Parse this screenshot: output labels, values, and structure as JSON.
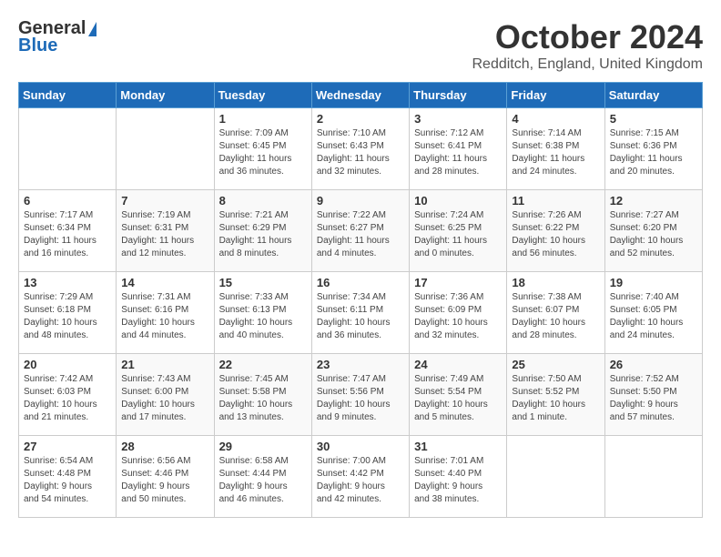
{
  "header": {
    "logo_general": "General",
    "logo_blue": "Blue",
    "month_title": "October 2024",
    "location": "Redditch, England, United Kingdom"
  },
  "weekdays": [
    "Sunday",
    "Monday",
    "Tuesday",
    "Wednesday",
    "Thursday",
    "Friday",
    "Saturday"
  ],
  "weeks": [
    [
      {
        "day": "",
        "info": ""
      },
      {
        "day": "",
        "info": ""
      },
      {
        "day": "1",
        "info": "Sunrise: 7:09 AM\nSunset: 6:45 PM\nDaylight: 11 hours\nand 36 minutes."
      },
      {
        "day": "2",
        "info": "Sunrise: 7:10 AM\nSunset: 6:43 PM\nDaylight: 11 hours\nand 32 minutes."
      },
      {
        "day": "3",
        "info": "Sunrise: 7:12 AM\nSunset: 6:41 PM\nDaylight: 11 hours\nand 28 minutes."
      },
      {
        "day": "4",
        "info": "Sunrise: 7:14 AM\nSunset: 6:38 PM\nDaylight: 11 hours\nand 24 minutes."
      },
      {
        "day": "5",
        "info": "Sunrise: 7:15 AM\nSunset: 6:36 PM\nDaylight: 11 hours\nand 20 minutes."
      }
    ],
    [
      {
        "day": "6",
        "info": "Sunrise: 7:17 AM\nSunset: 6:34 PM\nDaylight: 11 hours\nand 16 minutes."
      },
      {
        "day": "7",
        "info": "Sunrise: 7:19 AM\nSunset: 6:31 PM\nDaylight: 11 hours\nand 12 minutes."
      },
      {
        "day": "8",
        "info": "Sunrise: 7:21 AM\nSunset: 6:29 PM\nDaylight: 11 hours\nand 8 minutes."
      },
      {
        "day": "9",
        "info": "Sunrise: 7:22 AM\nSunset: 6:27 PM\nDaylight: 11 hours\nand 4 minutes."
      },
      {
        "day": "10",
        "info": "Sunrise: 7:24 AM\nSunset: 6:25 PM\nDaylight: 11 hours\nand 0 minutes."
      },
      {
        "day": "11",
        "info": "Sunrise: 7:26 AM\nSunset: 6:22 PM\nDaylight: 10 hours\nand 56 minutes."
      },
      {
        "day": "12",
        "info": "Sunrise: 7:27 AM\nSunset: 6:20 PM\nDaylight: 10 hours\nand 52 minutes."
      }
    ],
    [
      {
        "day": "13",
        "info": "Sunrise: 7:29 AM\nSunset: 6:18 PM\nDaylight: 10 hours\nand 48 minutes."
      },
      {
        "day": "14",
        "info": "Sunrise: 7:31 AM\nSunset: 6:16 PM\nDaylight: 10 hours\nand 44 minutes."
      },
      {
        "day": "15",
        "info": "Sunrise: 7:33 AM\nSunset: 6:13 PM\nDaylight: 10 hours\nand 40 minutes."
      },
      {
        "day": "16",
        "info": "Sunrise: 7:34 AM\nSunset: 6:11 PM\nDaylight: 10 hours\nand 36 minutes."
      },
      {
        "day": "17",
        "info": "Sunrise: 7:36 AM\nSunset: 6:09 PM\nDaylight: 10 hours\nand 32 minutes."
      },
      {
        "day": "18",
        "info": "Sunrise: 7:38 AM\nSunset: 6:07 PM\nDaylight: 10 hours\nand 28 minutes."
      },
      {
        "day": "19",
        "info": "Sunrise: 7:40 AM\nSunset: 6:05 PM\nDaylight: 10 hours\nand 24 minutes."
      }
    ],
    [
      {
        "day": "20",
        "info": "Sunrise: 7:42 AM\nSunset: 6:03 PM\nDaylight: 10 hours\nand 21 minutes."
      },
      {
        "day": "21",
        "info": "Sunrise: 7:43 AM\nSunset: 6:00 PM\nDaylight: 10 hours\nand 17 minutes."
      },
      {
        "day": "22",
        "info": "Sunrise: 7:45 AM\nSunset: 5:58 PM\nDaylight: 10 hours\nand 13 minutes."
      },
      {
        "day": "23",
        "info": "Sunrise: 7:47 AM\nSunset: 5:56 PM\nDaylight: 10 hours\nand 9 minutes."
      },
      {
        "day": "24",
        "info": "Sunrise: 7:49 AM\nSunset: 5:54 PM\nDaylight: 10 hours\nand 5 minutes."
      },
      {
        "day": "25",
        "info": "Sunrise: 7:50 AM\nSunset: 5:52 PM\nDaylight: 10 hours\nand 1 minute."
      },
      {
        "day": "26",
        "info": "Sunrise: 7:52 AM\nSunset: 5:50 PM\nDaylight: 9 hours\nand 57 minutes."
      }
    ],
    [
      {
        "day": "27",
        "info": "Sunrise: 6:54 AM\nSunset: 4:48 PM\nDaylight: 9 hours\nand 54 minutes."
      },
      {
        "day": "28",
        "info": "Sunrise: 6:56 AM\nSunset: 4:46 PM\nDaylight: 9 hours\nand 50 minutes."
      },
      {
        "day": "29",
        "info": "Sunrise: 6:58 AM\nSunset: 4:44 PM\nDaylight: 9 hours\nand 46 minutes."
      },
      {
        "day": "30",
        "info": "Sunrise: 7:00 AM\nSunset: 4:42 PM\nDaylight: 9 hours\nand 42 minutes."
      },
      {
        "day": "31",
        "info": "Sunrise: 7:01 AM\nSunset: 4:40 PM\nDaylight: 9 hours\nand 38 minutes."
      },
      {
        "day": "",
        "info": ""
      },
      {
        "day": "",
        "info": ""
      }
    ]
  ]
}
